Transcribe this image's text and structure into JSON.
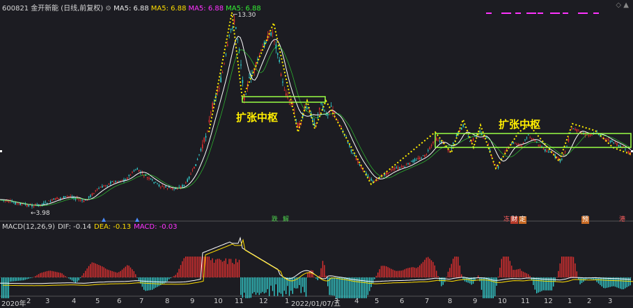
{
  "header": {
    "code": "600821",
    "name": "金开新能",
    "mode": "(日线,前复权)",
    "ma_items": [
      {
        "label": "MA5: 6.88",
        "color": "#e8e8e8"
      },
      {
        "label": "MA5: 6.88",
        "color": "#ffdd00"
      },
      {
        "label": "MA5: 6.88",
        "color": "#ff33ff"
      },
      {
        "label": "MA5: 6.88",
        "color": "#33ee33"
      }
    ]
  },
  "price_labels": {
    "high": "13.30",
    "low": "3.98"
  },
  "annotations": {
    "left": "扩张中枢",
    "right": "扩张中枢"
  },
  "events": [
    {
      "label": "跌",
      "style": "g"
    },
    {
      "label": "解",
      "style": "g"
    },
    {
      "label": "冻",
      "style": "t"
    },
    {
      "label": "财",
      "style": "r"
    },
    {
      "label": "定",
      "style": "o"
    },
    {
      "label": "预",
      "style": "o"
    },
    {
      "label": "港",
      "style": "t"
    }
  ],
  "macd": {
    "title": "MACD(12,26,9)",
    "dif": "DIF: -0.14",
    "dea": "DEA: -0.13",
    "macd": "MACD: -0.03"
  },
  "x_axis": {
    "labels": [
      "2020年",
      "2",
      "3",
      "4",
      "5",
      "6",
      "7",
      "8",
      "9",
      "10",
      "11",
      "12",
      "1",
      "2022/01/07/五",
      "3",
      "4",
      "5",
      "6",
      "7",
      "8",
      "9",
      "10",
      "11",
      "12",
      "1",
      "2",
      "3"
    ]
  },
  "colors": {
    "background": "#1c1c22",
    "up": "#e03030",
    "down": "#33cccc",
    "ma_line": "#ffffff",
    "zigzag": "#ffee00",
    "zone": "#99ff44",
    "dif": "#ffffff",
    "dea": "#ffdd00",
    "macd_up": "#e03030",
    "macd_down": "#33cccc",
    "accent": "#ff33ff"
  },
  "chart_data": {
    "type": "candlestick",
    "price_series": {
      "months": [
        "2020-01",
        "2020-02",
        "2020-03",
        "2020-04",
        "2020-05",
        "2020-06",
        "2020-07",
        "2020-08",
        "2020-09",
        "2020-10",
        "2020-11",
        "2020-12",
        "2021-01",
        "2021-02",
        "2021-03",
        "2021-04",
        "2021-05",
        "2021-06",
        "2021-07",
        "2021-08",
        "2021-09",
        "2021-10",
        "2021-11",
        "2021-12",
        "2022-01",
        "2022-02",
        "2022-03"
      ],
      "close_approx": [
        4.3,
        4.1,
        4.3,
        4.4,
        4.9,
        5.3,
        5.0,
        5.1,
        7.5,
        11.5,
        10.0,
        8.0,
        7.0,
        6.5,
        5.6,
        5.9,
        6.4,
        6.9,
        7.6,
        7.7,
        7.2,
        6.9,
        7.1,
        7.4,
        7.7,
        7.4,
        7.0
      ]
    },
    "high": 13.3,
    "low": 3.98
  }
}
